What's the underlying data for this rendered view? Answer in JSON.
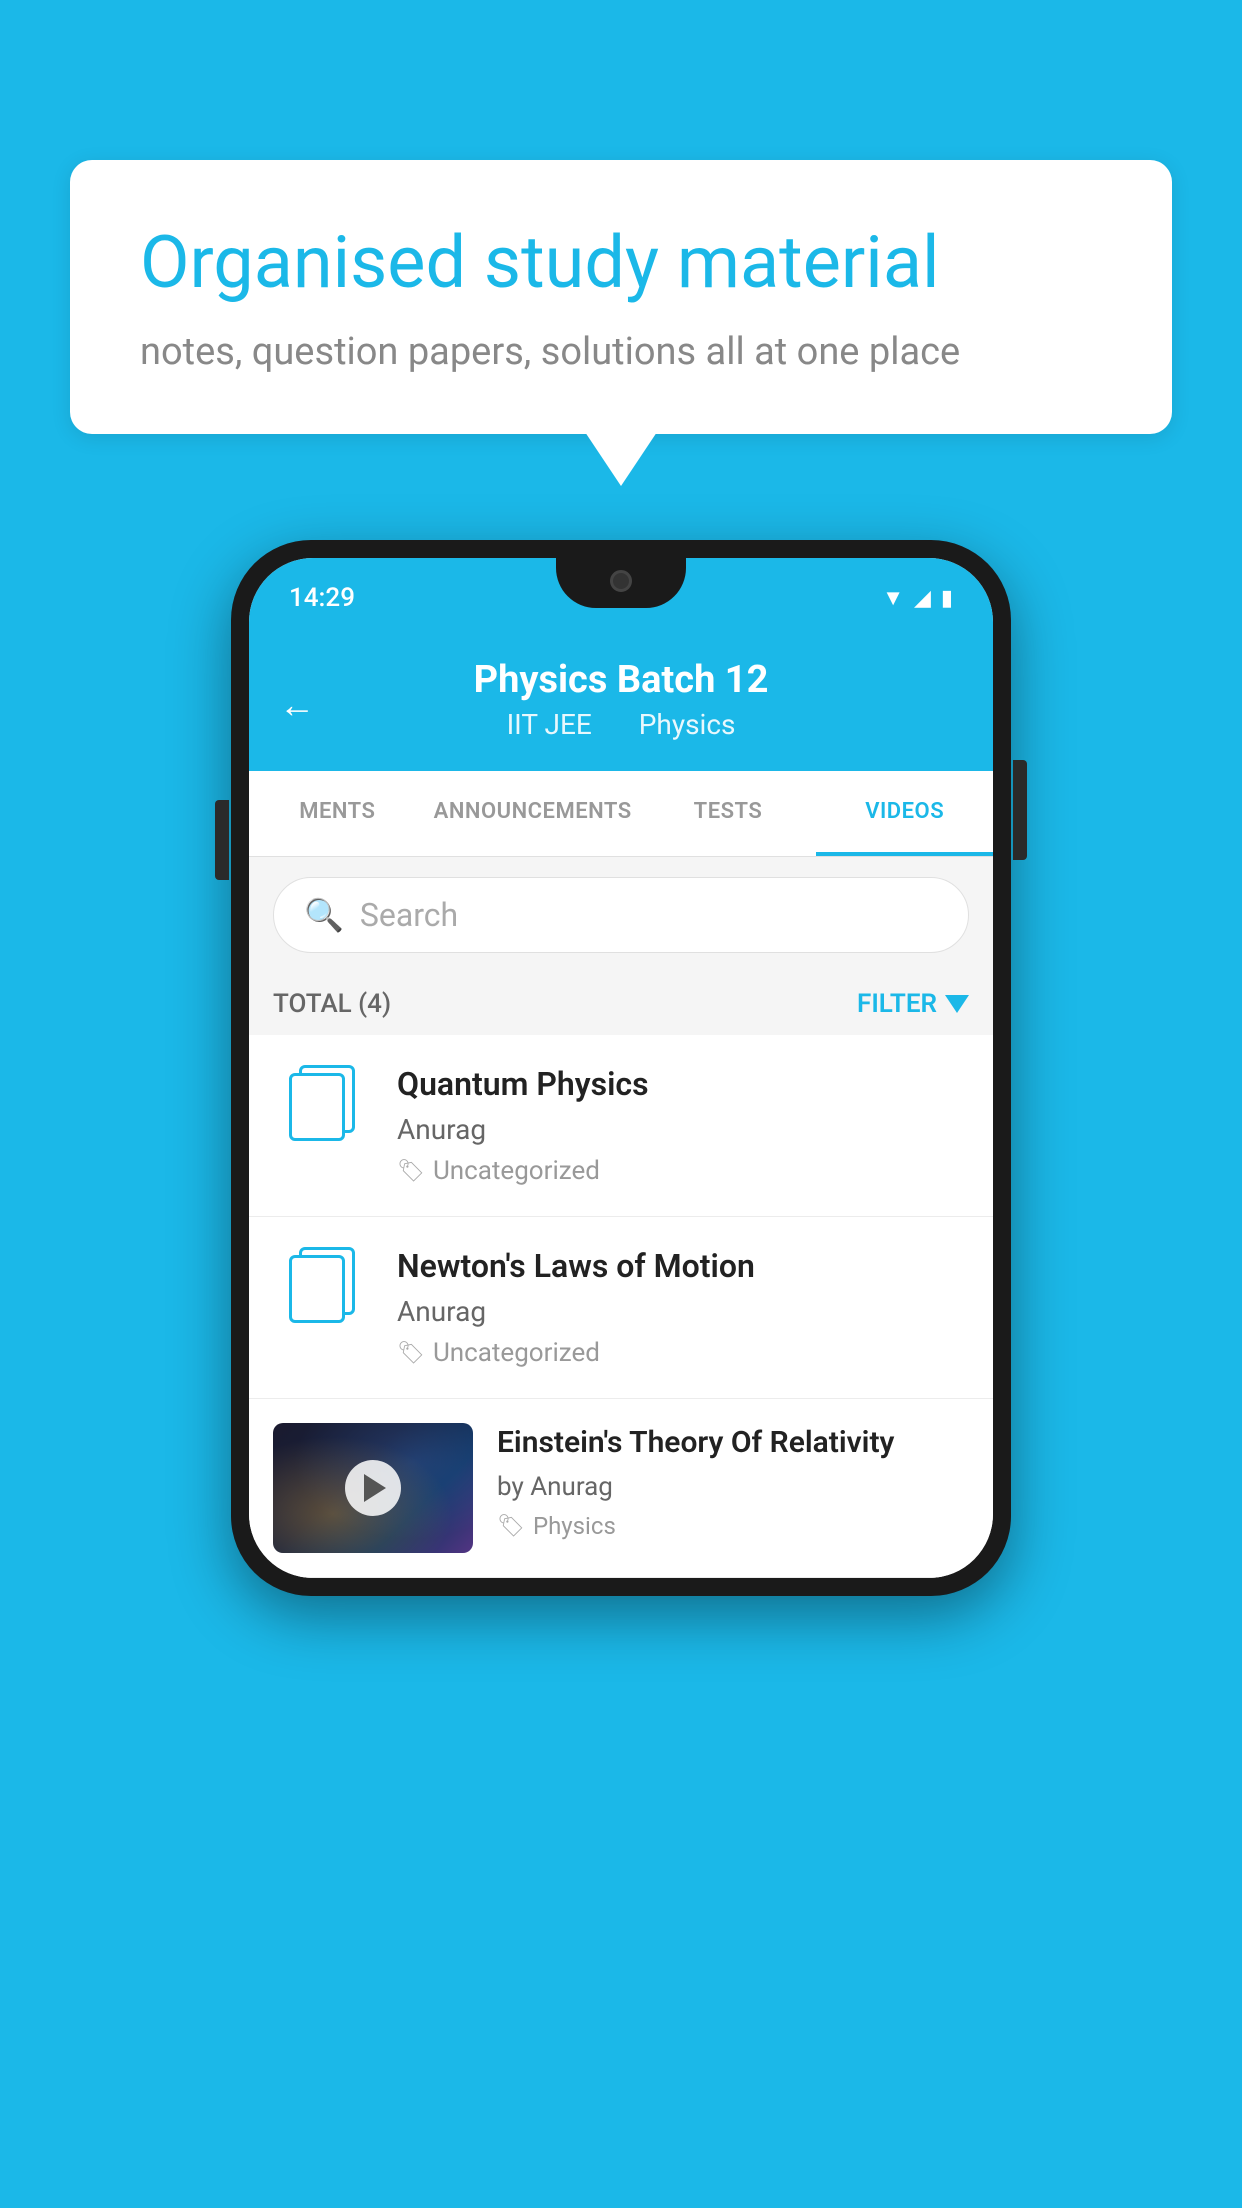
{
  "background_color": "#1BB8E8",
  "speech_bubble": {
    "title": "Organised study material",
    "subtitle": "notes, question papers, solutions all at one place"
  },
  "phone": {
    "status_bar": {
      "time": "14:29"
    },
    "header": {
      "back_label": "←",
      "title": "Physics Batch 12",
      "subtitle_tag1": "IIT JEE",
      "subtitle_tag2": "Physics"
    },
    "tabs": [
      {
        "label": "MENTS",
        "active": false
      },
      {
        "label": "ANNOUNCEMENTS",
        "active": false
      },
      {
        "label": "TESTS",
        "active": false
      },
      {
        "label": "VIDEOS",
        "active": true
      }
    ],
    "search": {
      "placeholder": "Search"
    },
    "filter": {
      "total_label": "TOTAL (4)",
      "filter_label": "FILTER"
    },
    "videos": [
      {
        "id": "quantum",
        "title": "Quantum Physics",
        "author": "Anurag",
        "tag": "Uncategorized",
        "type": "file"
      },
      {
        "id": "newton",
        "title": "Newton's Laws of Motion",
        "author": "Anurag",
        "tag": "Uncategorized",
        "type": "file"
      },
      {
        "id": "einstein",
        "title": "Einstein's Theory Of Relativity",
        "author": "by Anurag",
        "tag": "Physics",
        "type": "video"
      }
    ]
  }
}
